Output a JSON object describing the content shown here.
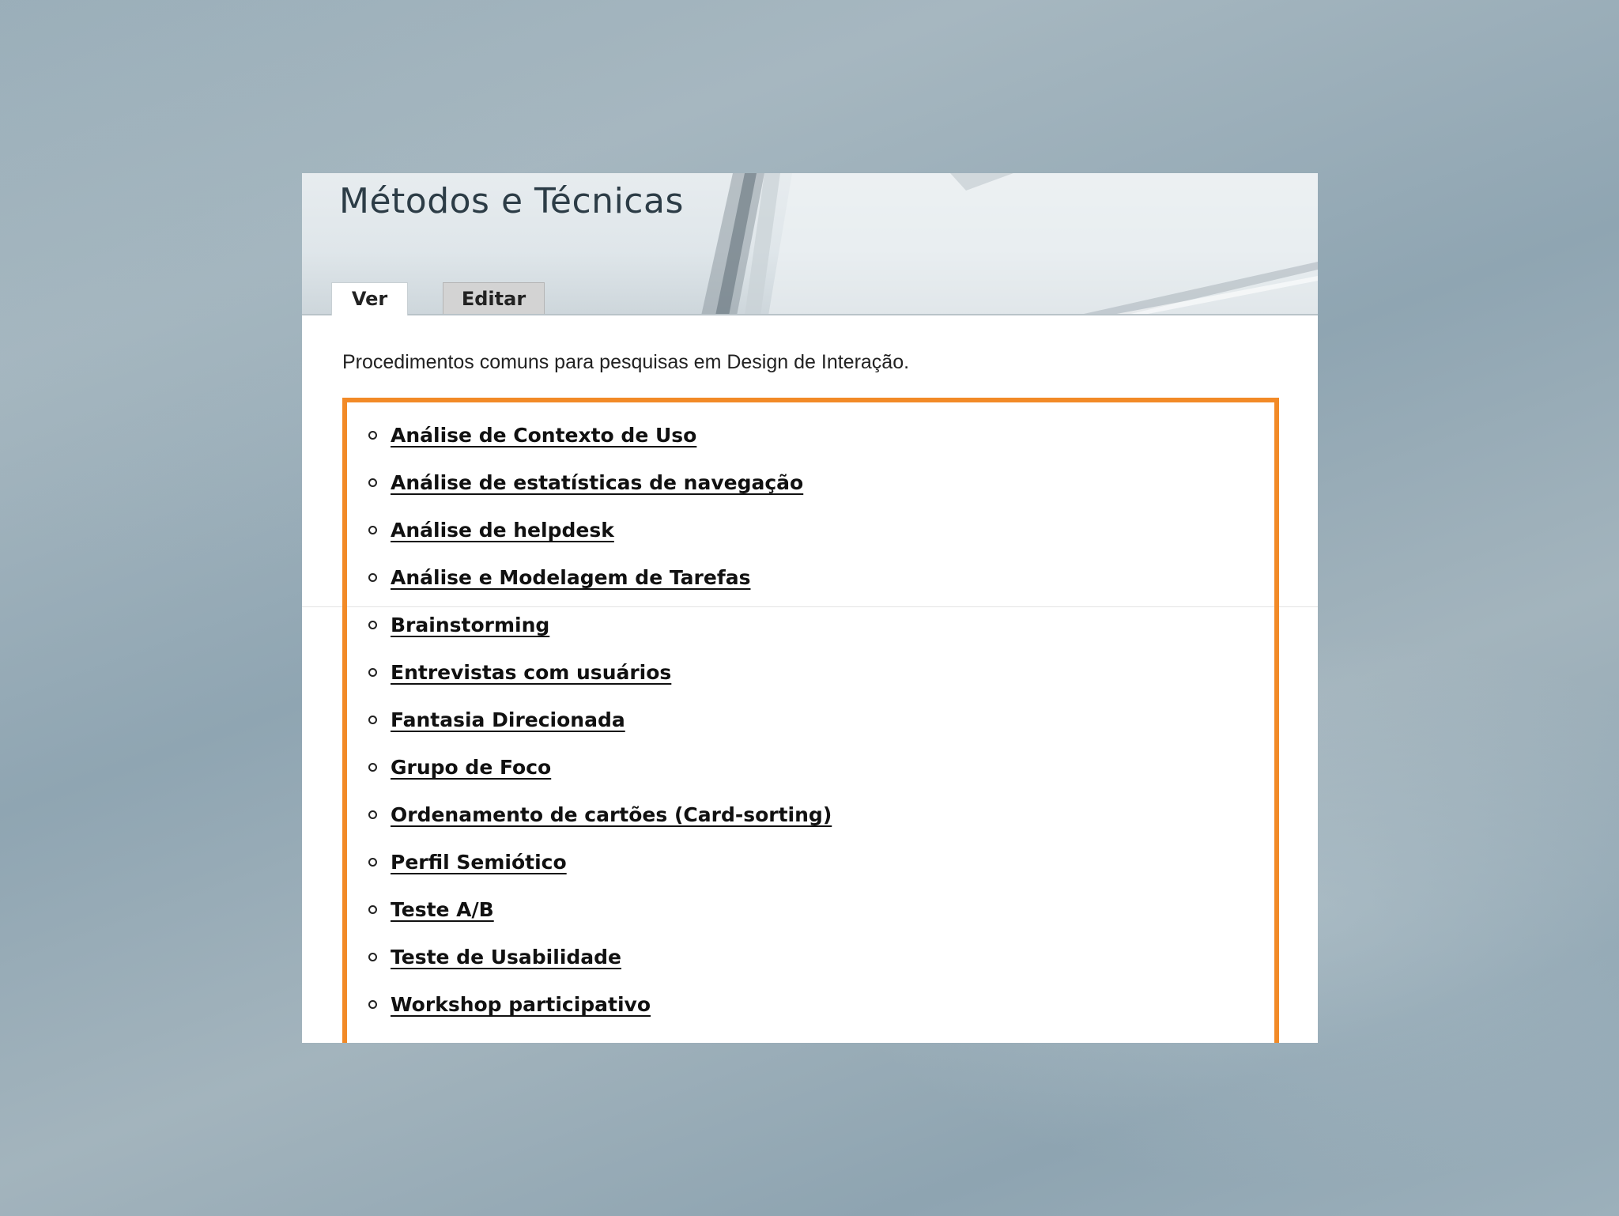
{
  "header": {
    "title": "Métodos e Técnicas"
  },
  "tabs": [
    {
      "label": "Ver",
      "active": true
    },
    {
      "label": "Editar",
      "active": false
    }
  ],
  "content": {
    "intro": "Procedimentos comuns para pesquisas em Design de Interação.",
    "methods": [
      "Análise de Contexto de Uso",
      "Análise de estatísticas de navegação",
      "Análise de helpdesk",
      "Análise e Modelagem de Tarefas",
      "Brainstorming",
      "Entrevistas com usuários",
      "Fantasia Direcionada",
      "Grupo de Foco",
      "Ordenamento de cartões (Card-sorting)",
      "Perfil Semiótico",
      "Teste A/B",
      "Teste de Usabilidade",
      "Workshop participativo"
    ]
  },
  "colors": {
    "highlight_border": "#f28a27",
    "slide_background": "#9aaeb9",
    "active_tab": "#ffffff",
    "inactive_tab": "#d3d3d3"
  }
}
